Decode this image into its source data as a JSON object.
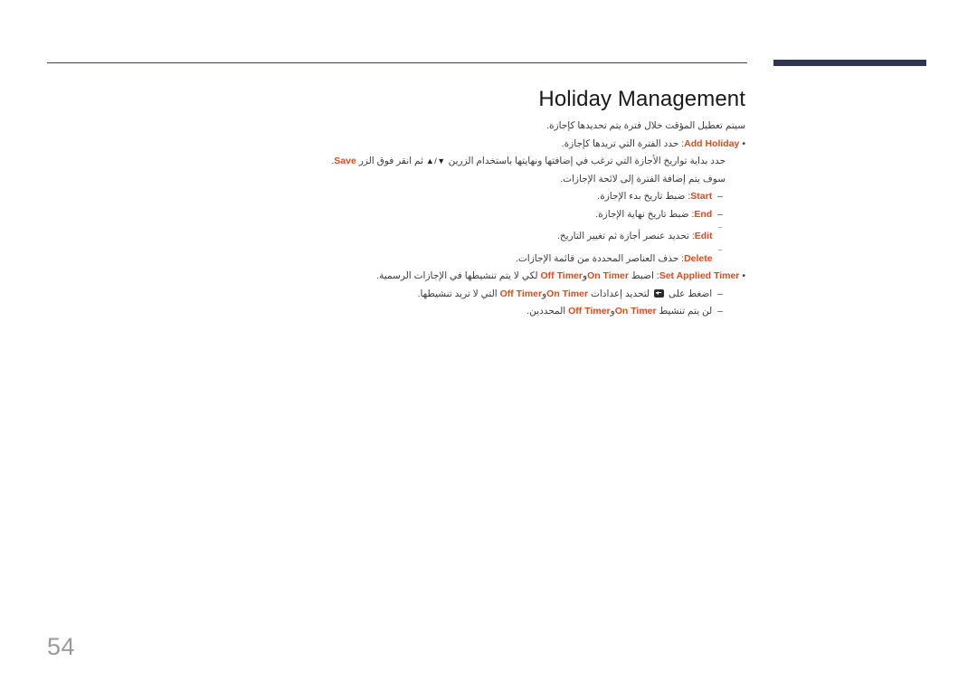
{
  "document": {
    "page_number": "54",
    "title": "Holiday Management",
    "accent_color": "#e1491b",
    "rule_color": "#2e3550"
  },
  "body": {
    "intro": "سيتم تعطيل المؤقت خلال فترة يتم تحديدها كإجازة.",
    "items": [
      {
        "bullet": "•",
        "keyword": "Add Holiday",
        "text_after_keyword": ": حدد الفترة التي تريدها كإجازة."
      },
      {
        "text_before": "حدد بداية تواريخ الأجازة التي ترغب في إضافتها ونهايتها باستخدام الزرين",
        "arrows": "▲/▼",
        "text_middle": "ثم انقر فوق الزر",
        "keyword": "Save",
        "text_after": "."
      },
      {
        "text": "سوف يتم إضافة الفترة إلى لائحة الإجازات."
      },
      {
        "dash": "–",
        "keyword": "Start",
        "text_after_keyword": ": ضبط تاريخ بدء الإجازة."
      },
      {
        "dash": "–",
        "keyword": "End",
        "text_after_keyword": ": ضبط تاريخ نهاية الإجازة."
      },
      {
        "dash": "‾",
        "keyword": "Edit",
        "text_after_keyword": ": تحديد عنصر أجازة ثم تغيير التاريخ."
      },
      {
        "dash": "‾",
        "keyword": "Delete",
        "text_after_keyword": ": حذف العناصر المحددة من قائمة الإجازات."
      },
      {
        "bullet": "•",
        "keyword": "Set Applied Timer",
        "text_after_keyword": ": اضبط",
        "keyword2": "On Timer",
        "text_joiner": "و",
        "keyword3": "Off Timer",
        "text_end": "لكي لا يتم تنشيطها في الإجازات الرسمية."
      },
      {
        "dash": "–",
        "text_before": "اضغط على",
        "icon": "enter-key-icon",
        "text_middle": "لتحديد إعدادات",
        "keyword": "On Timer",
        "text_joiner": "و",
        "keyword2": "Off Timer",
        "text_end": "التي لا تريد تنشيطها."
      },
      {
        "dash": "–",
        "text_before": "لن يتم تنشيط",
        "keyword": "On Timer",
        "text_joiner": "و",
        "keyword2": "Off Timer",
        "text_end": "المحددين."
      }
    ]
  }
}
